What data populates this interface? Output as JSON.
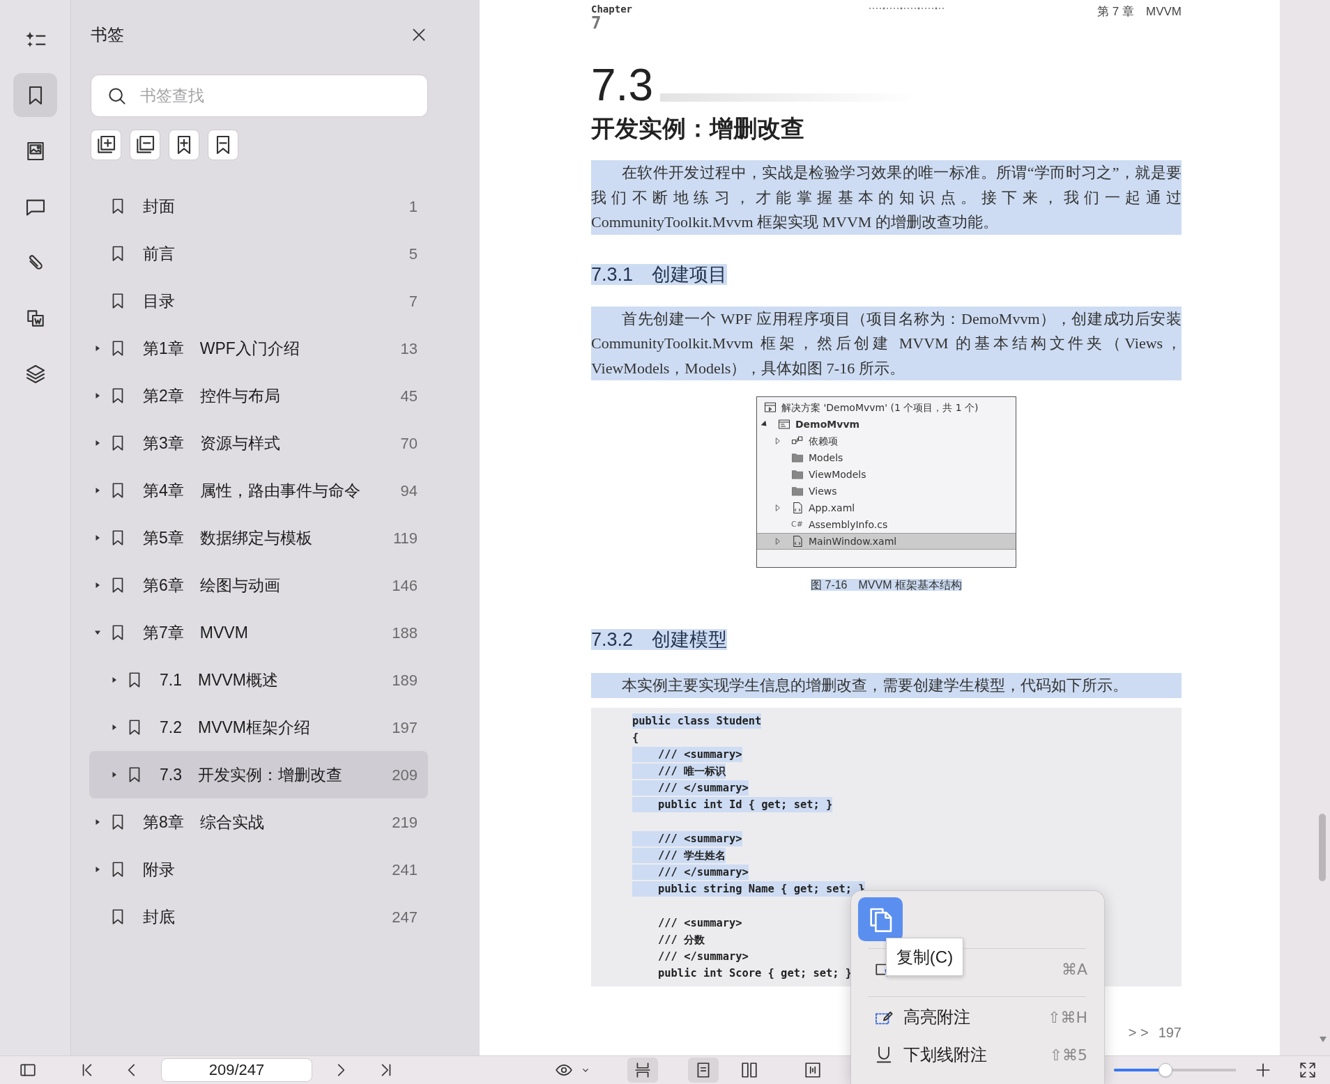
{
  "rail": [
    {
      "kind": "outline",
      "selected": false
    },
    {
      "kind": "bookmarks",
      "selected": true
    },
    {
      "kind": "thumbnails",
      "selected": false
    },
    {
      "kind": "comments",
      "selected": false
    },
    {
      "kind": "attachments",
      "selected": false
    },
    {
      "kind": "convert",
      "selected": false
    },
    {
      "kind": "layers",
      "selected": false
    }
  ],
  "sidebar": {
    "title": "书签",
    "search": {
      "placeholder": "书签查找"
    },
    "tools": [
      {
        "kind": "expand-all"
      },
      {
        "kind": "collapse-all"
      },
      {
        "kind": "add-bookmark"
      },
      {
        "kind": "remove-bookmark"
      }
    ],
    "bookmarks": [
      {
        "label": "封面",
        "page": "1",
        "selected": false
      },
      {
        "label": "前言",
        "page": "5",
        "selected": false
      },
      {
        "label": "目录",
        "page": "7",
        "selected": false
      },
      {
        "label": "第1章　WPF入门介绍",
        "page": "13",
        "selected": false,
        "expanded": false
      },
      {
        "label": "第2章　控件与布局",
        "page": "45",
        "selected": false,
        "expanded": false
      },
      {
        "label": "第3章　资源与样式",
        "page": "70",
        "selected": false,
        "expanded": false
      },
      {
        "label": "第4章　属性，路由事件与命令",
        "page": "94",
        "selected": false,
        "expanded": false
      },
      {
        "label": "第5章　数据绑定与模板",
        "page": "119",
        "selected": false,
        "expanded": false
      },
      {
        "label": "第6章　绘图与动画",
        "page": "146",
        "selected": false,
        "expanded": false
      },
      {
        "label": "第7章　MVVM",
        "page": "188",
        "selected": false,
        "expanded": true,
        "children": [
          {
            "label": "7.1　MVVM概述",
            "page": "189",
            "selected": false,
            "expanded": false
          },
          {
            "label": "7.2　MVVM框架介绍",
            "page": "197",
            "selected": false,
            "expanded": false
          },
          {
            "label": "7.3　开发实例：增删改查",
            "page": "209",
            "selected": true,
            "expanded": false
          }
        ]
      },
      {
        "label": "第8章　综合实战",
        "page": "219",
        "selected": false,
        "expanded": false
      },
      {
        "label": "附录",
        "page": "241",
        "selected": false,
        "expanded": false
      },
      {
        "label": "封底",
        "page": "247",
        "selected": false
      }
    ]
  },
  "document": {
    "header": {
      "chapter_label": "Chapter",
      "chapter_number": "7",
      "running_title": "第 7 章　MVVM"
    },
    "section_number": "7.3",
    "section_title": "开发实例：增删改查",
    "blocks": [
      {
        "kind": "paragraph",
        "selected": true,
        "text": "在软件开发过程中，实战是检验学习效果的唯一标准。所谓“学而时习之”，就是要我们不断地练习，才能掌握基本的知识点。接下来，我们一起通过 CommunityToolkit.Mvvm 框架实现 MVVM 的增删改查功能。"
      },
      {
        "kind": "heading",
        "selected": true,
        "text": "7.3.1　创建项目"
      },
      {
        "kind": "paragraph",
        "selected": true,
        "text": "首先创建一个 WPF 应用程序项目（项目名称为：DemoMvvm），创建成功后安装 CommunityToolkit.Mvvm 框架，然后创建 MVVM 的基本结构文件夹（Views，ViewModels，Models），具体如图 7-16 所示。"
      },
      {
        "kind": "figure",
        "caption": "图 7-16　MVVM 框架基本结构",
        "caption_selected": true,
        "tree": [
          {
            "kind": "solution",
            "label": "解决方案 'DemoMvvm' (1 个项目，共 1 个)",
            "selected": false
          },
          {
            "kind": "project",
            "label": "DemoMvvm",
            "selected": false,
            "expanded": true,
            "children": [
              {
                "kind": "dependencies",
                "label": "依赖项",
                "selected": false,
                "expanded": false
              },
              {
                "kind": "folder",
                "label": "Models",
                "selected": false
              },
              {
                "kind": "folder",
                "label": "ViewModels",
                "selected": false
              },
              {
                "kind": "folder",
                "label": "Views",
                "selected": false
              },
              {
                "kind": "xaml",
                "label": "App.xaml",
                "selected": false,
                "expanded": false
              },
              {
                "kind": "cs",
                "icon_text": "C#",
                "label": "AssemblyInfo.cs",
                "selected": false
              },
              {
                "kind": "xaml",
                "label": "MainWindow.xaml",
                "selected": true,
                "expanded": false
              }
            ]
          }
        ]
      },
      {
        "kind": "heading",
        "selected": true,
        "text": "7.3.2　创建模型"
      },
      {
        "kind": "paragraph",
        "selected": true,
        "text": "本实例主要实现学生信息的增删改查，需要创建学生模型，代码如下所示。"
      },
      {
        "kind": "code",
        "groups": [
          [
            {
              "text": "public class Student",
              "selected": true
            },
            {
              "text": "{",
              "selected": false
            },
            {
              "text": "    /// <summary>",
              "selected": true
            },
            {
              "text": "    /// 唯一标识",
              "selected": true
            },
            {
              "text": "    /// </summary>",
              "selected": true
            },
            {
              "text": "    public int Id { get; set; }",
              "selected": true
            }
          ],
          [
            {
              "text": "    /// <summary>",
              "selected": true
            },
            {
              "text": "    /// 学生姓名",
              "selected": true
            },
            {
              "text": "    /// </summary>",
              "selected": true
            },
            {
              "text": "    public string Name { get; set; }",
              "selected": true
            }
          ],
          [
            {
              "text": "    /// <summary>",
              "selected": false
            },
            {
              "text": "    /// 分数",
              "selected": false
            },
            {
              "text": "    /// </summary>",
              "selected": false
            },
            {
              "text": "    public int Score { get; set; }",
              "selected": false
            }
          ]
        ]
      }
    ],
    "footer": {
      "marker": "> >",
      "page": "197"
    }
  },
  "context_menu": {
    "copy": {
      "tooltip": "复制(C)"
    },
    "groups": [
      [
        {
          "kind": "select",
          "shortcut": "⌘A"
        }
      ],
      [
        {
          "kind": "highlight",
          "label": "高亮附注",
          "shortcut": "⇧⌘H"
        },
        {
          "kind": "underline",
          "label": "下划线附注",
          "shortcut": "⇧⌘5"
        }
      ]
    ]
  },
  "toolbar": {
    "page_field": {
      "value": "209/247"
    },
    "view_buttons": [
      {
        "kind": "continuous",
        "selected": true
      },
      {
        "kind": "single",
        "selected": true
      },
      {
        "kind": "two-page",
        "selected": false
      },
      {
        "kind": "cover",
        "selected": false
      }
    ],
    "zoom": {
      "level": 0.42
    }
  }
}
